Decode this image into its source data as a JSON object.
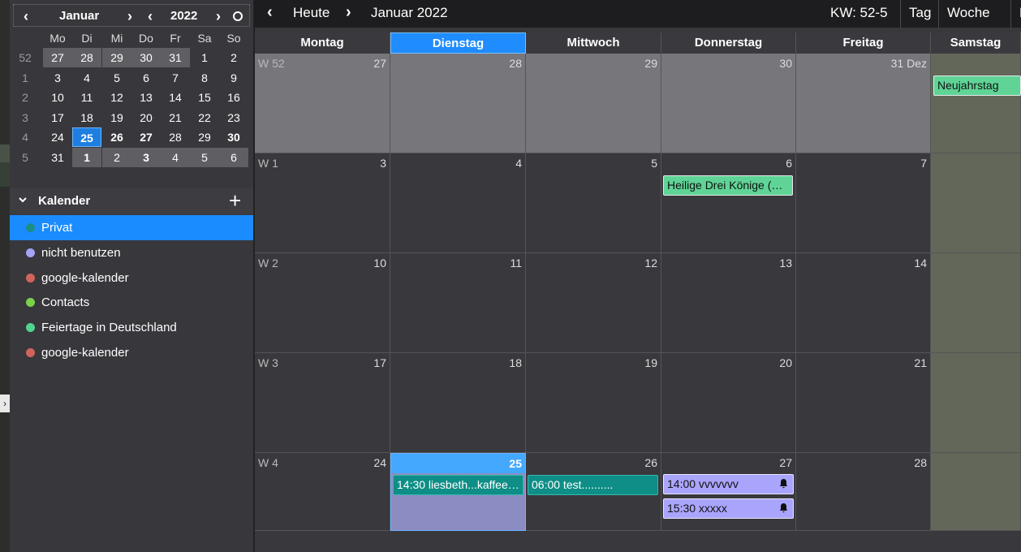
{
  "minical": {
    "month": "Januar",
    "year": "2022",
    "prev_month": "‹",
    "next_month": "›",
    "prev_year": "‹",
    "next_year": "›",
    "dow": [
      "Mo",
      "Di",
      "Mi",
      "Do",
      "Fr",
      "Sa",
      "So"
    ],
    "weeks": [
      {
        "wk": "52",
        "days": [
          "27",
          "28",
          "29",
          "30",
          "31",
          "1",
          "2"
        ]
      },
      {
        "wk": "1",
        "days": [
          "3",
          "4",
          "5",
          "6",
          "7",
          "8",
          "9"
        ]
      },
      {
        "wk": "2",
        "days": [
          "10",
          "11",
          "12",
          "13",
          "14",
          "15",
          "16"
        ]
      },
      {
        "wk": "3",
        "days": [
          "17",
          "18",
          "19",
          "20",
          "21",
          "22",
          "23"
        ]
      },
      {
        "wk": "4",
        "days": [
          "24",
          "25",
          "26",
          "27",
          "28",
          "29",
          "30"
        ]
      },
      {
        "wk": "5",
        "days": [
          "31",
          "1",
          "2",
          "3",
          "4",
          "5",
          "6"
        ]
      }
    ]
  },
  "calendars": {
    "section_label": "Kalender",
    "add_label": "+",
    "items": [
      {
        "name": "Privat",
        "color": "#1c8e86"
      },
      {
        "name": "nicht benutzen",
        "color": "#a5a3f5"
      },
      {
        "name": "google-kalender",
        "color": "#d0645d"
      },
      {
        "name": "Contacts",
        "color": "#7ad14a"
      },
      {
        "name": "Feiertage in Deutschland",
        "color": "#4fd58f"
      },
      {
        "name": "google-kalender",
        "color": "#d0645d"
      }
    ]
  },
  "toolbar": {
    "prev": "‹",
    "today": "Heute",
    "next": "›",
    "period": "Januar 2022",
    "kw": "KW: 52-5",
    "view_day": "Tag",
    "view_week": "Woche",
    "view_month": "M"
  },
  "grid": {
    "headers": [
      "Montag",
      "Dienstag",
      "Mittwoch",
      "Donnerstag",
      "Freitag",
      "Samstag"
    ],
    "rows": [
      {
        "wk": "W 52",
        "days": [
          "27",
          "28",
          "29",
          "30",
          "31 Dez",
          ""
        ]
      },
      {
        "wk": "W 1",
        "days": [
          "3",
          "4",
          "5",
          "6",
          "7",
          ""
        ]
      },
      {
        "wk": "W 2",
        "days": [
          "10",
          "11",
          "12",
          "13",
          "14",
          ""
        ]
      },
      {
        "wk": "W 3",
        "days": [
          "17",
          "18",
          "19",
          "20",
          "21",
          ""
        ]
      },
      {
        "wk": "W 4",
        "days": [
          "24",
          "25",
          "26",
          "27",
          "28",
          ""
        ]
      }
    ],
    "events": {
      "neujahr": "Neujahrstag",
      "dreikoenige": "Heilige Drei Könige (…",
      "liesbeth": "14:30 liesbeth...kaffee…",
      "test": "06:00 test..........",
      "vvv": "14:00 vvvvvvv",
      "xxx": "15:30 xxxxx"
    }
  }
}
